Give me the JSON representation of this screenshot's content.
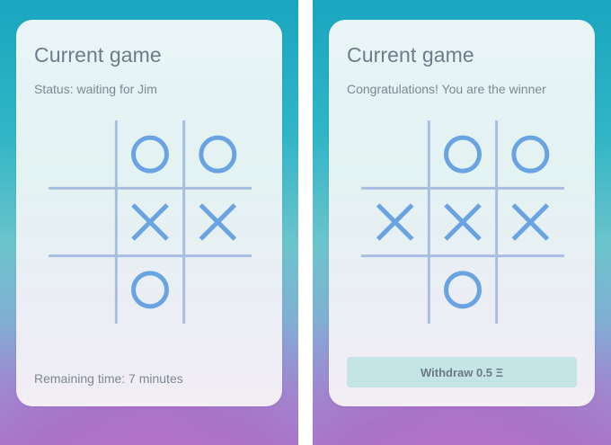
{
  "left_screen": {
    "title": "Current game",
    "status": "Status: waiting for Jim",
    "remaining_time": "Remaining time: 7 minutes",
    "board": [
      "",
      "O",
      "O",
      "",
      "X",
      "X",
      "",
      "O",
      ""
    ]
  },
  "right_screen": {
    "title": "Current game",
    "status": "Congratulations! You are the winner",
    "withdraw_label": "Withdraw 0.5 Ξ",
    "board": [
      "",
      "O",
      "O",
      "X",
      "X",
      "X",
      "",
      "O",
      ""
    ]
  },
  "colors": {
    "mark": "#6aa3e2",
    "grid": "#a8bee0",
    "card_text": "#6f7b8c",
    "button_bg": "#c4e4e6"
  },
  "icons": {
    "x_mark": "x-mark-icon",
    "o_mark": "o-mark-icon"
  }
}
